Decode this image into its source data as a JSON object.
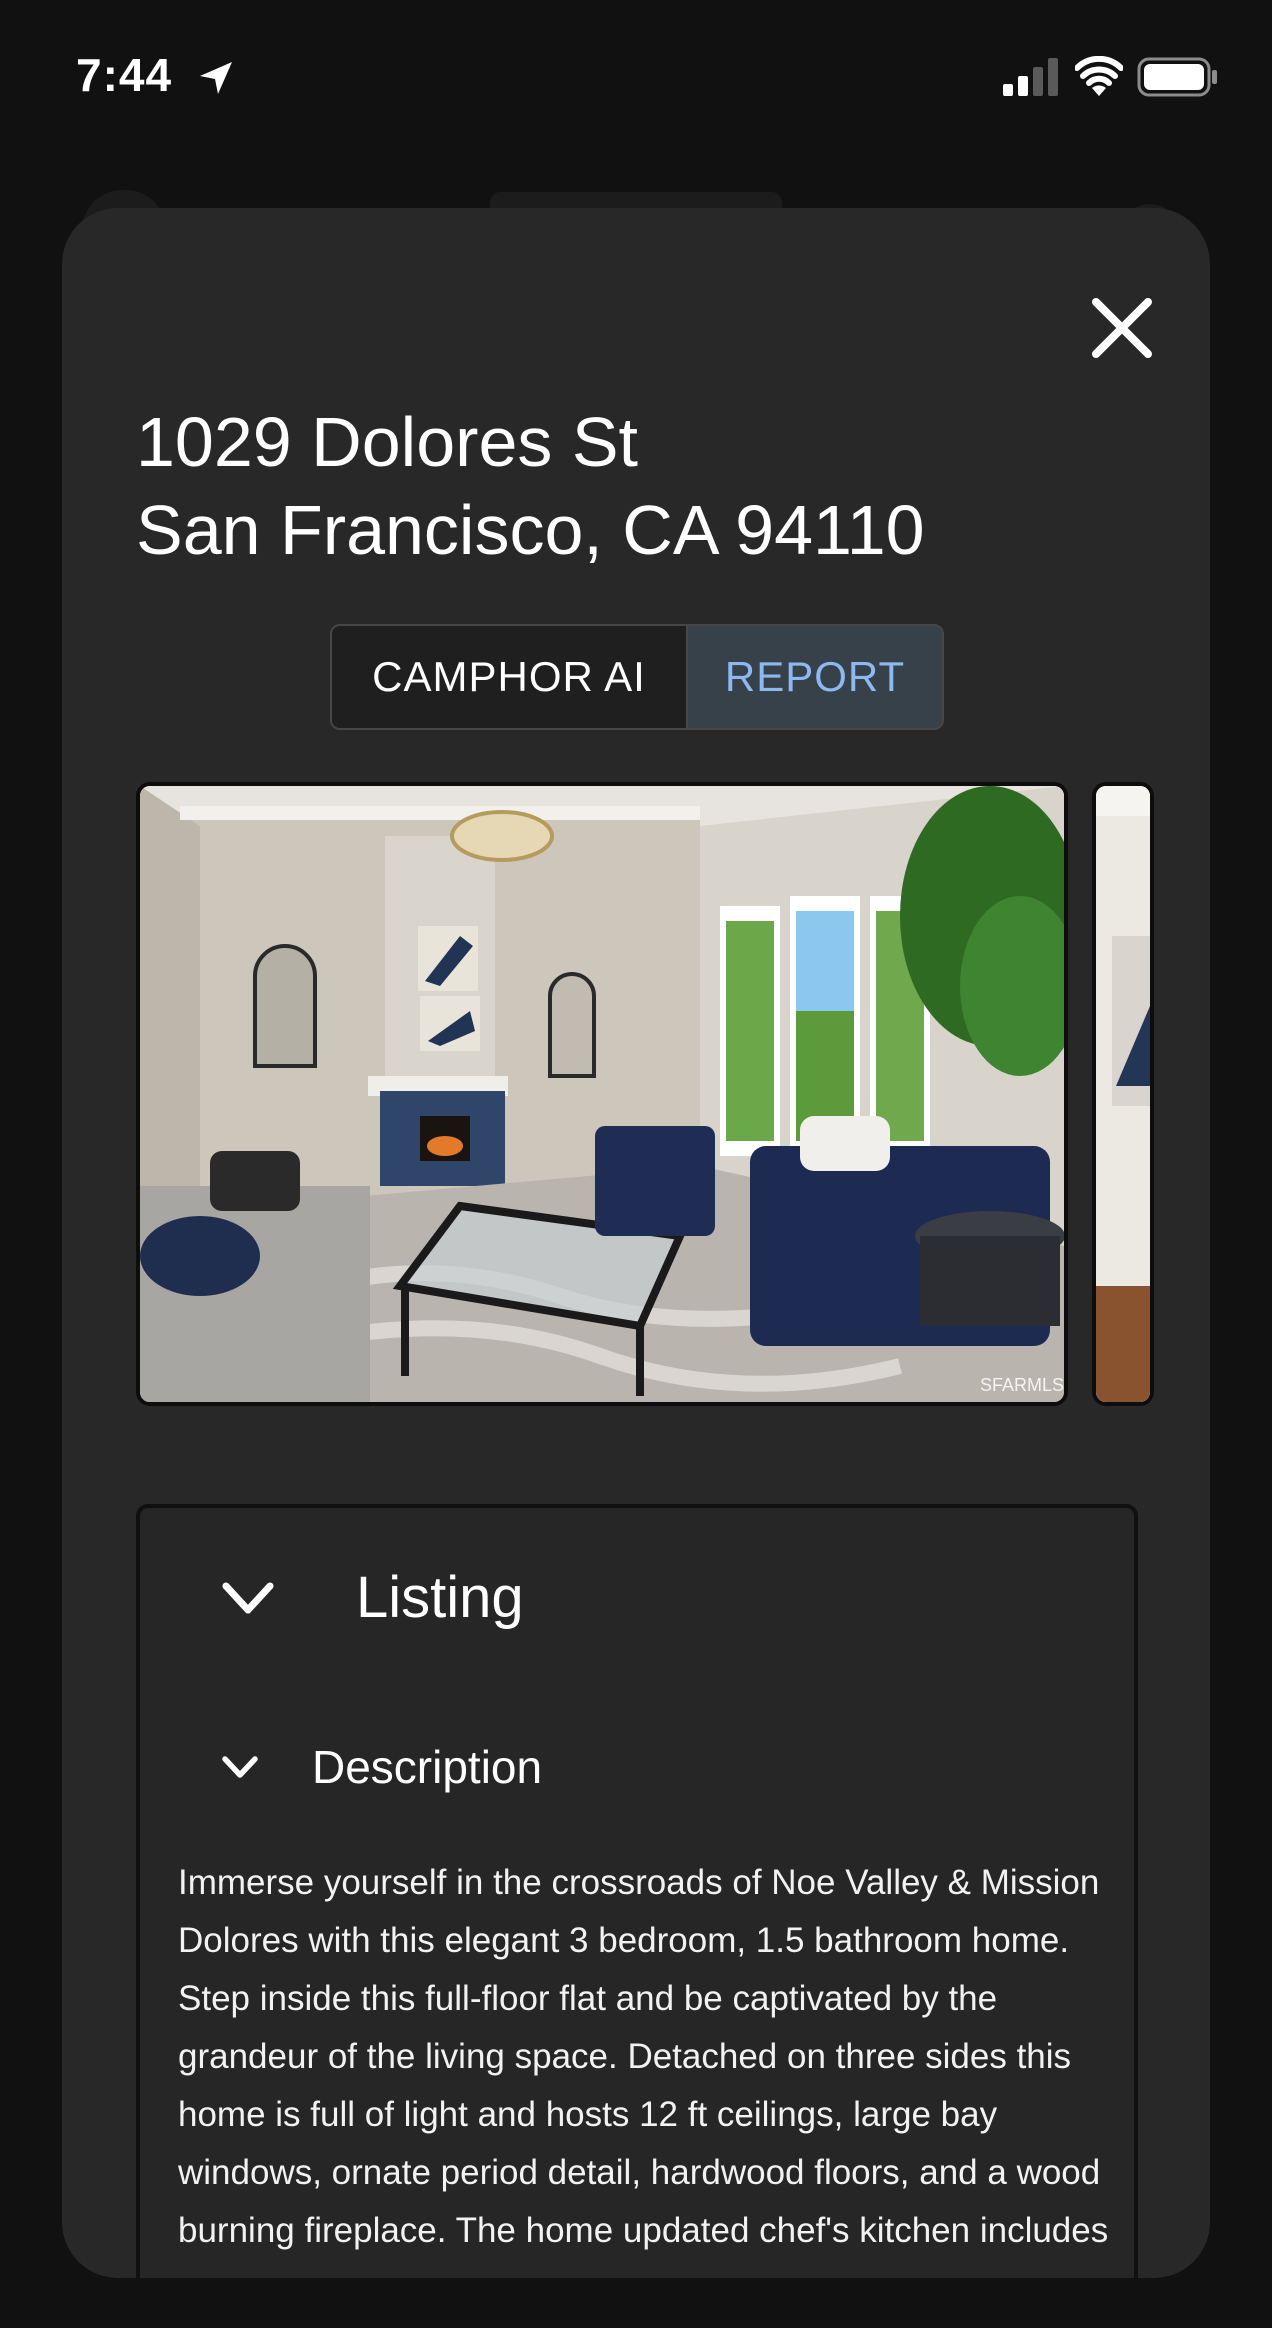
{
  "status_bar": {
    "time": "7:44",
    "icons": [
      "location-arrow-icon",
      "cellular-signal-icon",
      "wifi-icon",
      "battery-icon"
    ]
  },
  "sheet": {
    "close_icon": "close-icon",
    "address_line1": "1029 Dolores St",
    "address_line2": "San Francisco, CA 94110",
    "tabs": [
      {
        "label": "CAMPHOR AI",
        "active": false
      },
      {
        "label": "REPORT",
        "active": true
      }
    ],
    "photo_watermark": "SFARMLS",
    "listing": {
      "title": "Listing",
      "expanded": true,
      "description_title": "Description",
      "description_text": "Immerse yourself in the crossroads of Noe Valley & Mission Dolores with this elegant 3 bedroom, 1.5 bathroom home. Step inside this full-floor flat and be captivated by the grandeur of the living space. Detached on three sides this home is full of light and hosts 12 ft ceilings, large bay windows, ornate period detail, hardwood floors, and a wood burning fireplace. The home updated chef's kitchen includes"
    }
  },
  "colors": {
    "background": "#111111",
    "sheet": "#282828",
    "tab_active_text": "#8db8f0",
    "tab_active_bg": "#37414a"
  }
}
